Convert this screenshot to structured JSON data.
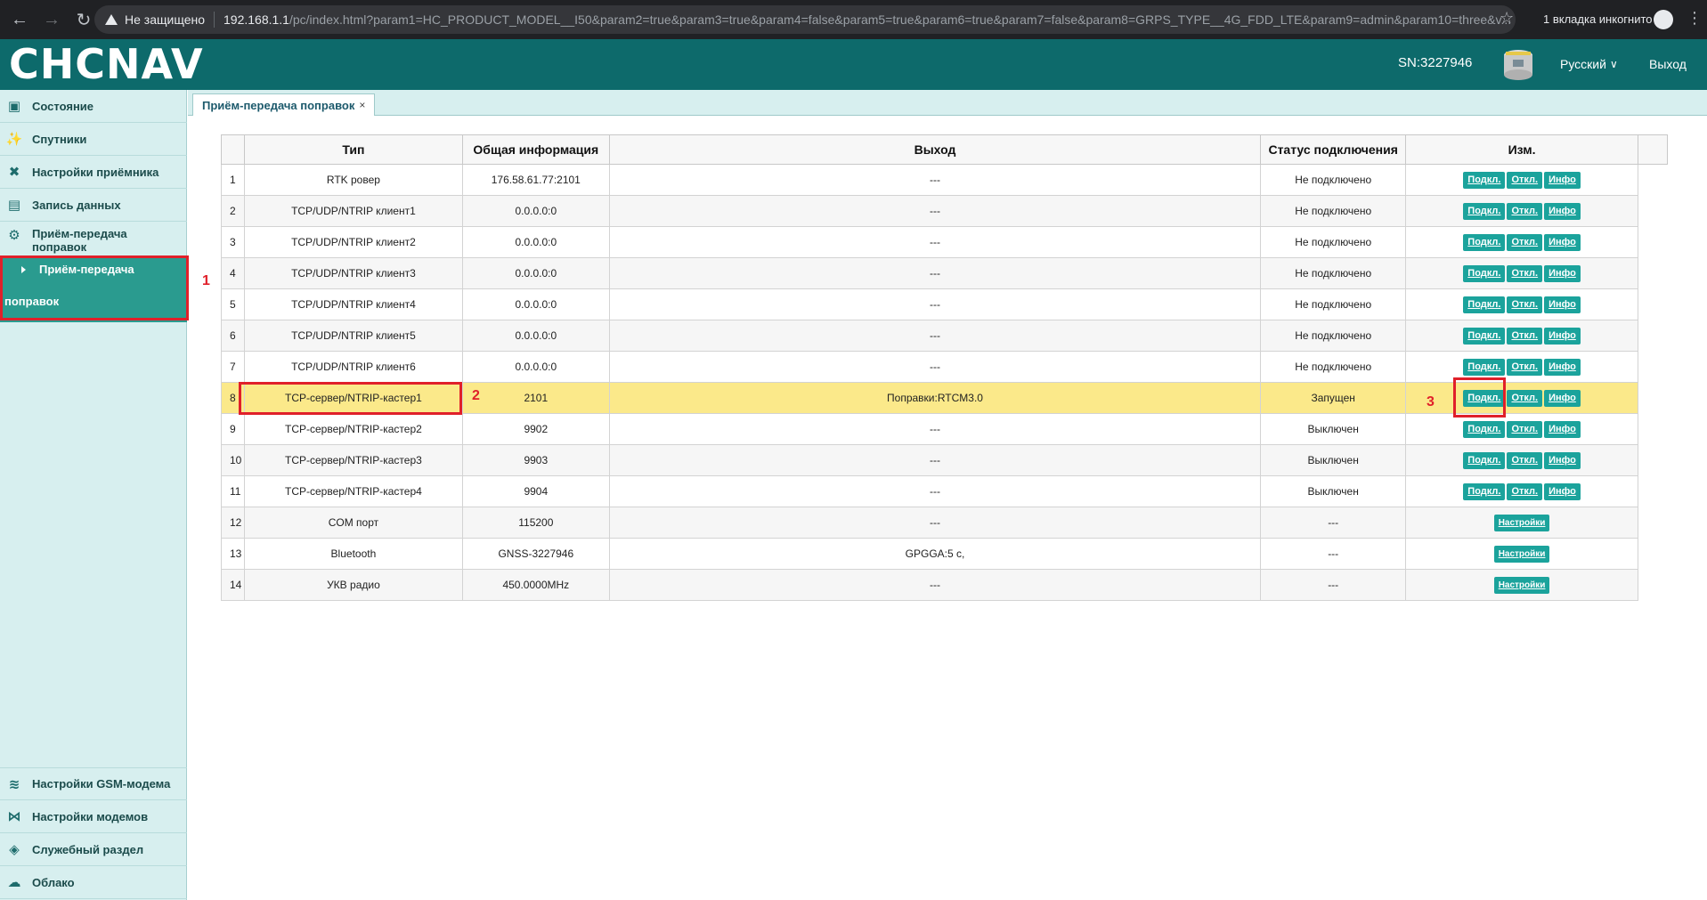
{
  "browser": {
    "insecure": "Не защищено",
    "host": "192.168.1.1",
    "path": "/pc/index.html?param1=HC_PRODUCT_MODEL__I50&param2=true&param3=true&param4=false&param5=true&param6=true&param7=false&param8=GRPS_TYPE__4G_FDD_LTE&param9=admin&param10=three&v...",
    "incognito": "1 вкладка инкогнито"
  },
  "header": {
    "logo": "CHCNAV",
    "sn": "SN:3227946",
    "language": "Русский",
    "logout": "Выход"
  },
  "sidebar": {
    "items": [
      {
        "label": "Состояние",
        "icon": "status-icon"
      },
      {
        "label": "Спутники",
        "icon": "satellite-icon"
      },
      {
        "label": "Настройки приёмника",
        "icon": "tools-icon"
      },
      {
        "label": "Запись данных",
        "icon": "log-icon"
      },
      {
        "label": "Приём-передача поправок",
        "icon": "gear-icon"
      }
    ],
    "sub_l1": "Приём-передача",
    "sub_l2": "поправок",
    "bottom": [
      {
        "label": "Настройки GSM-модема",
        "icon": "wifi-icon"
      },
      {
        "label": "Настройки модемов",
        "icon": "modem-icon"
      },
      {
        "label": "Служебный раздел",
        "icon": "layers-icon"
      },
      {
        "label": "Облако",
        "icon": "cloud-icon"
      }
    ]
  },
  "tab": {
    "label": "Приём-передача поправок",
    "close": "×"
  },
  "table": {
    "headers": [
      "Тип",
      "Общая информация",
      "Выход",
      "Статус подключения",
      "Изм."
    ],
    "rows": [
      {
        "n": "1",
        "type": "RTK ровер",
        "info": "176.58.61.77:2101",
        "out": "---",
        "status": "Не подключено"
      },
      {
        "n": "2",
        "type": "TCP/UDP/NTRIP клиент1",
        "info": "0.0.0.0:0",
        "out": "---",
        "status": "Не подключено"
      },
      {
        "n": "3",
        "type": "TCP/UDP/NTRIP клиент2",
        "info": "0.0.0.0:0",
        "out": "---",
        "status": "Не подключено"
      },
      {
        "n": "4",
        "type": "TCP/UDP/NTRIP клиент3",
        "info": "0.0.0.0:0",
        "out": "---",
        "status": "Не подключено"
      },
      {
        "n": "5",
        "type": "TCP/UDP/NTRIP клиент4",
        "info": "0.0.0.0:0",
        "out": "---",
        "status": "Не подключено"
      },
      {
        "n": "6",
        "type": "TCP/UDP/NTRIP клиент5",
        "info": "0.0.0.0:0",
        "out": "---",
        "status": "Не подключено"
      },
      {
        "n": "7",
        "type": "TCP/UDP/NTRIP клиент6",
        "info": "0.0.0.0:0",
        "out": "---",
        "status": "Не подключено"
      },
      {
        "n": "8",
        "type": "TCP-сервер/NTRIP-кастер1",
        "info": "2101",
        "out": "Поправки:RTCM3.0",
        "status": "Запущен"
      },
      {
        "n": "9",
        "type": "TCP-сервер/NTRIP-кастер2",
        "info": "9902",
        "out": "---",
        "status": "Выключен"
      },
      {
        "n": "10",
        "type": "TCP-сервер/NTRIP-кастер3",
        "info": "9903",
        "out": "---",
        "status": "Выключен"
      },
      {
        "n": "11",
        "type": "TCP-сервер/NTRIP-кастер4",
        "info": "9904",
        "out": "---",
        "status": "Выключен"
      },
      {
        "n": "12",
        "type": "COM порт",
        "info": "115200",
        "out": "---",
        "status": "---"
      },
      {
        "n": "13",
        "type": "Bluetooth",
        "info": "GNSS-3227946",
        "out": "GPGGA:5 с,",
        "status": "---"
      },
      {
        "n": "14",
        "type": "УКВ радио",
        "info": "450.0000MHz",
        "out": "---",
        "status": "---"
      }
    ],
    "btn_connect": "Подкл.",
    "btn_disconnect": "Откл.",
    "btn_info": "Инфо",
    "btn_settings": "Настройки"
  },
  "callouts": [
    "1",
    "2",
    "3"
  ],
  "colors": {
    "header": "#0d6a6b",
    "sidebar": "#d7efef",
    "accent": "#1ba39c",
    "highlight": "#fbe98a",
    "callout": "#e0202a"
  }
}
